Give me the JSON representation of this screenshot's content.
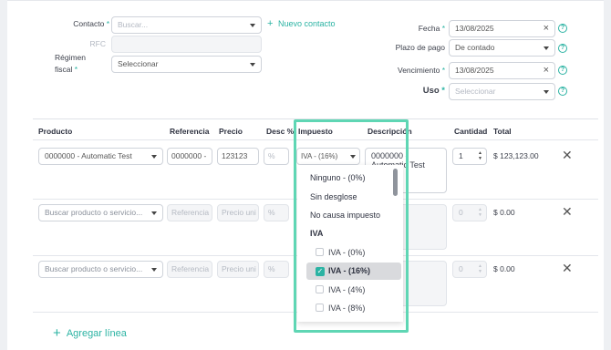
{
  "header": {
    "contacto": {
      "label": "Contacto",
      "placeholder": "Buscar...",
      "new_link": "Nuevo contacto"
    },
    "rfc": {
      "label": "RFC"
    },
    "regimen": {
      "label_line1": "Régimen",
      "label_line2": "fiscal",
      "value": "Seleccionar"
    },
    "fecha": {
      "label": "Fecha",
      "value": "13/08/2025"
    },
    "plazo": {
      "label": "Plazo de pago",
      "value": "De contado"
    },
    "vencimiento": {
      "label": "Vencimiento",
      "value": "13/08/2025"
    },
    "uso": {
      "label": "Uso",
      "value": "Seleccionar"
    },
    "required_mark": "*",
    "plus_glyph": "+",
    "clear_glyph": "×",
    "help_glyph": "?"
  },
  "table": {
    "columns": [
      "Producto",
      "Referencia",
      "Precio",
      "Desc %",
      "Impuesto",
      "Descripción",
      "Cantidad",
      "Total"
    ],
    "rows": [
      {
        "producto": "0000000 - Automatic Test",
        "referencia": "0000000 -",
        "precio": "123123",
        "desc": "%",
        "impuesto": "IVA - (16%)",
        "descripcion": "0000000 - Automatic Test",
        "cantidad": "1",
        "total": "$ 123,123.00"
      },
      {
        "producto": "Buscar producto o servicio...",
        "referencia": "Referencia",
        "precio": "Precio uni",
        "desc": "%",
        "cantidad": "0",
        "total": "$ 0.00"
      },
      {
        "producto": "Buscar producto o servicio...",
        "referencia": "Referencia",
        "precio": "Precio uni",
        "desc": "%",
        "cantidad": "0",
        "total": "$ 0.00"
      }
    ],
    "remove_glyph": "✕",
    "add_line": "Agregar línea",
    "stepper_up": "▲",
    "stepper_down": "▼"
  },
  "tax_dropdown": {
    "options_top": [
      "Ninguno - (0%)",
      "Sin desglose",
      "No causa impuesto"
    ],
    "group_label": "IVA",
    "group_options": [
      {
        "label": "IVA - (0%)",
        "checked": false
      },
      {
        "label": "IVA - (16%)",
        "checked": true
      },
      {
        "label": "IVA - (4%)",
        "checked": false
      },
      {
        "label": "IVA - (8%)",
        "checked": false
      }
    ],
    "check_glyph": "✓"
  },
  "colors": {
    "accent": "#2bb3a3",
    "highlight": "#5fd6b4"
  }
}
